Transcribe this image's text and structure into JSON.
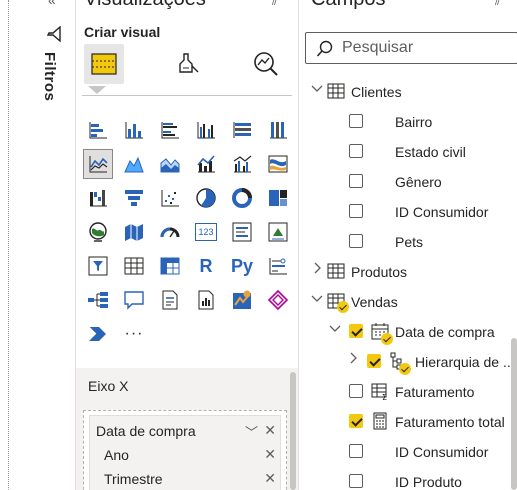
{
  "filters_pane": {
    "label": "Filtros"
  },
  "visualizations_pane": {
    "title": "Visualizações",
    "subtitle": "Criar visual",
    "tabs": [
      {
        "name": "build-visual",
        "selected": true
      },
      {
        "name": "format-visual",
        "selected": false
      },
      {
        "name": "analytics",
        "selected": false
      }
    ],
    "icons": [
      "stacked-bar-icon",
      "stacked-column-icon",
      "clustered-bar-icon",
      "clustered-column-icon",
      "100-stacked-bar-icon",
      "100-stacked-column-icon",
      "line-chart-icon",
      "area-chart-icon",
      "stacked-area-icon",
      "line-and-column-icon",
      "line-and-clustered-column-icon",
      "ribbon-chart-icon",
      "waterfall-icon",
      "funnel-icon",
      "scatter-icon",
      "pie-chart-icon",
      "donut-chart-icon",
      "treemap-icon",
      "map-icon",
      "filled-map-icon",
      "gauge-icon",
      "card-icon",
      "multi-row-card-icon",
      "kpi-icon",
      "slicer-icon",
      "table-icon",
      "matrix-icon",
      "r-visual-icon",
      "python-visual-icon",
      "key-influencers-icon",
      "decomposition-tree-icon",
      "qa-icon",
      "smart-narrative-icon",
      "paginated-report-icon",
      "arcgis-map-icon",
      "power-apps-icon",
      "power-automate-icon",
      "more-visuals-icon"
    ],
    "text_icons": {
      "card": "123",
      "r": "R",
      "python": "Py",
      "more": "···"
    },
    "wells": {
      "section_label": "Eixo X",
      "field_name": "Data de compra",
      "subfields": [
        "Ano",
        "Trimestre"
      ]
    }
  },
  "fields_pane": {
    "title": "Campos",
    "search_placeholder": "Pesquisar",
    "tables": [
      {
        "name": "Clientes",
        "expanded": true,
        "fields": [
          {
            "name": "Bairro",
            "checked": false
          },
          {
            "name": "Estado civil",
            "checked": false
          },
          {
            "name": "Gênero",
            "checked": false
          },
          {
            "name": "ID Consumidor",
            "checked": false
          },
          {
            "name": "Pets",
            "checked": false
          }
        ]
      },
      {
        "name": "Produtos",
        "expanded": false,
        "fields": []
      },
      {
        "name": "Vendas",
        "expanded": true,
        "fields": [
          {
            "name": "Data de compra",
            "checked": true,
            "type": "date"
          },
          {
            "name": "Hierarquia de ...",
            "checked": true,
            "type": "hierarchy"
          },
          {
            "name": "Faturamento",
            "checked": false,
            "type": "measure"
          },
          {
            "name": "Faturamento total",
            "checked": true,
            "type": "calculator"
          },
          {
            "name": "ID Consumidor",
            "checked": false
          },
          {
            "name": "ID Produto",
            "checked": false
          }
        ]
      }
    ]
  },
  "colors": {
    "accent_yellow": "#f2c811",
    "icon_blue": "#2a64b8",
    "icon_teal": "#118dff"
  }
}
